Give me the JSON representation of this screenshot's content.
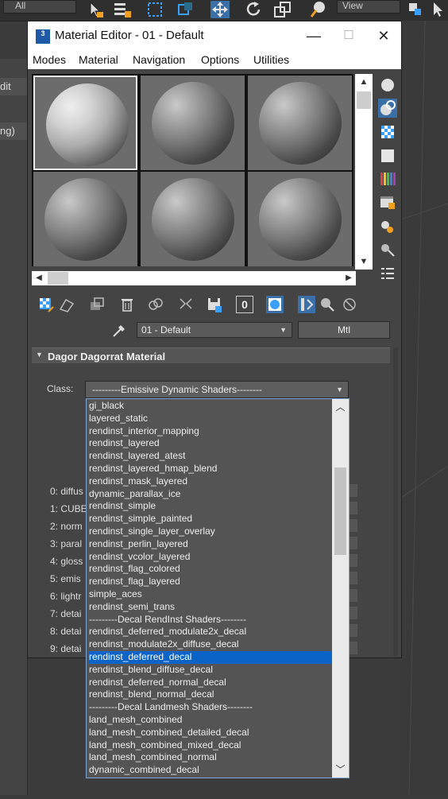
{
  "background_app": {
    "toolbar": {
      "selection_filter": "All",
      "view_dropdown": "View"
    },
    "left_panel": {
      "edit_fragment": "dit",
      "config_fragment": "ng)"
    }
  },
  "window": {
    "title": "Material Editor - 01 - Default",
    "app_icon_text": "3",
    "controls": {
      "minimize": "—",
      "maximize": "☐",
      "close": "✕"
    },
    "menu": [
      "Modes",
      "Material",
      "Navigation",
      "Options",
      "Utilities"
    ]
  },
  "name_bar": {
    "material_name": "01 - Default",
    "type_button": "Mtl",
    "bottom_toolbar_zero": "0"
  },
  "rollout": {
    "title": "Dagor Dagorrat Material"
  },
  "class_field": {
    "label": "Class:",
    "value": "---------Emissive Dynamic Shaders--------"
  },
  "params": [
    "0:  diffus",
    "1:  CUBE",
    "2:  norm",
    "3:  paral",
    "4:  gloss",
    "5:  emis",
    "6:  lightr",
    "7:  detai",
    "8:  detai",
    "9:  detai"
  ],
  "dropdown": {
    "selected_index": 20,
    "items": [
      "gi_black",
      "layered_static",
      "rendinst_interior_mapping",
      "rendinst_layered",
      "rendinst_layered_atest",
      "rendinst_layered_hmap_blend",
      "rendinst_mask_layered",
      "dynamic_parallax_ice",
      "rendinst_simple",
      "rendinst_simple_painted",
      "rendinst_single_layer_overlay",
      "rendinst_perlin_layered",
      "rendinst_vcolor_layered",
      "rendinst_flag_colored",
      "rendinst_flag_layered",
      "simple_aces",
      "rendinst_semi_trans",
      "---------Decal RendInst Shaders--------",
      "rendinst_deferred_modulate2x_decal",
      "rendinst_modulate2x_diffuse_decal",
      "rendinst_deferred_decal",
      "rendinst_blend_diffuse_decal",
      "rendinst_deferred_normal_decal",
      "rendinst_blend_normal_decal",
      "---------Decal Landmesh Shaders--------",
      "land_mesh_combined",
      "land_mesh_combined_detailed_decal",
      "land_mesh_combined_mixed_decal",
      "land_mesh_combined_normal",
      "dynamic_combined_decal"
    ]
  },
  "colors": {
    "selection": "#0a64c8",
    "panel": "#444444",
    "titlebar": "#ffffff"
  }
}
